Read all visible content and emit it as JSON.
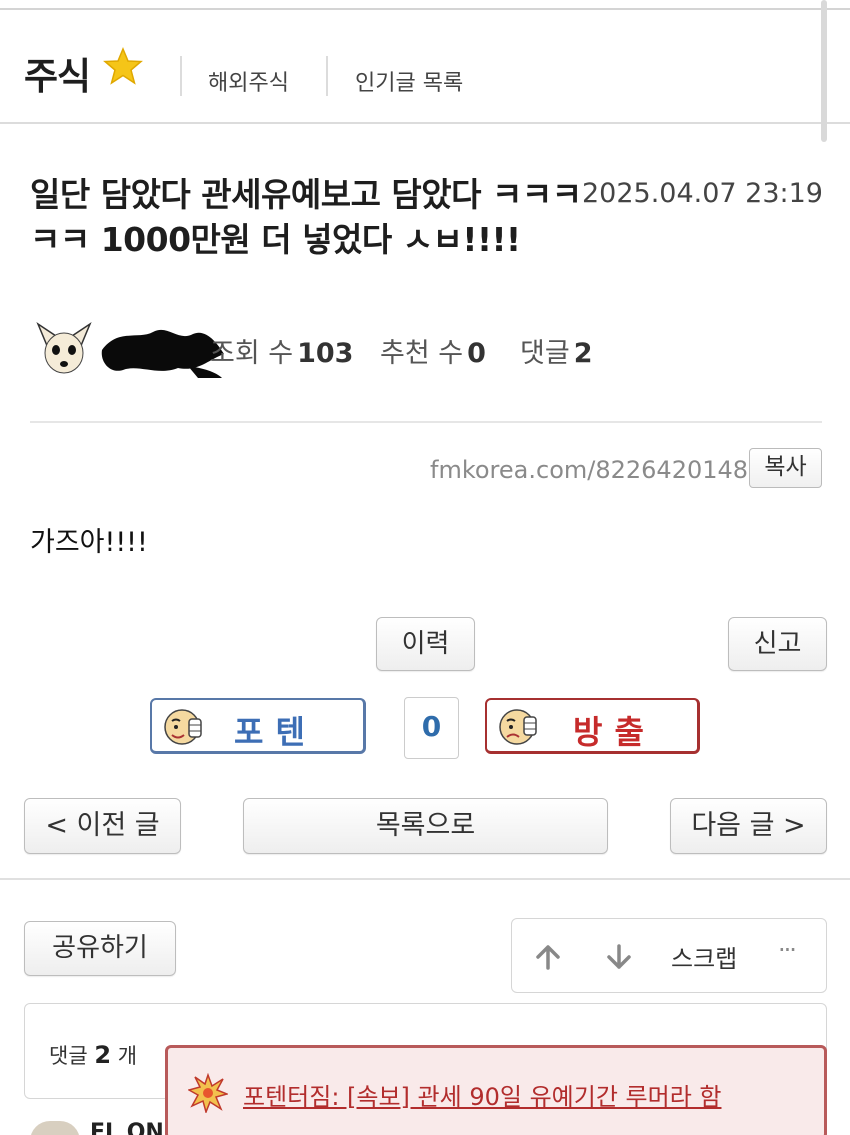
{
  "header": {
    "board_title": "주식",
    "links": [
      "해외주식",
      "인기글 목록"
    ]
  },
  "post": {
    "title": "일단 담았다 관세유예보고 담았다 ㅋㅋㅋㅋㅋ 1000만원 더 넣었다 ㅅㅂ!!!!",
    "date": "2025.04.07 23:19",
    "stats": {
      "views_label": "조회 수",
      "views": "103",
      "recommend_label": "추천 수",
      "recommend": "0",
      "comments_label": "댓글",
      "comments": "2"
    },
    "url": "fmkorea.com/8226420148",
    "copy_label": "복사",
    "content": "가즈아!!!!"
  },
  "actions": {
    "history_label": "이력",
    "report_label": "신고",
    "vote_up_label": "포텐",
    "vote_down_label": "방출",
    "vote_count": "0",
    "prev_label": "< 이전 글",
    "list_label": "목록으로",
    "next_label": "다음 글 >",
    "share_label": "공유하기",
    "scrap_label": "스크랩",
    "more_label": "···"
  },
  "comments": {
    "label_prefix": "댓글",
    "count": "2",
    "label_suffix": "개",
    "next_author_partial": "EL ON"
  },
  "notice": {
    "text": "포텐터짐: [속보] 관세 90일 유예기간 루머라 함"
  },
  "colors": {
    "vote_up": "#3d6eb5",
    "vote_down": "#c62b2b",
    "notice_border": "#b85a5a",
    "notice_bg": "#f9eaea",
    "star": "#f5c518"
  },
  "icons": [
    "star-icon",
    "avatar-dog",
    "smiley-thumbs-up-icon",
    "smiley-thumbs-down-icon",
    "arrow-up-icon",
    "arrow-down-icon",
    "more-icon",
    "burst-icon"
  ]
}
